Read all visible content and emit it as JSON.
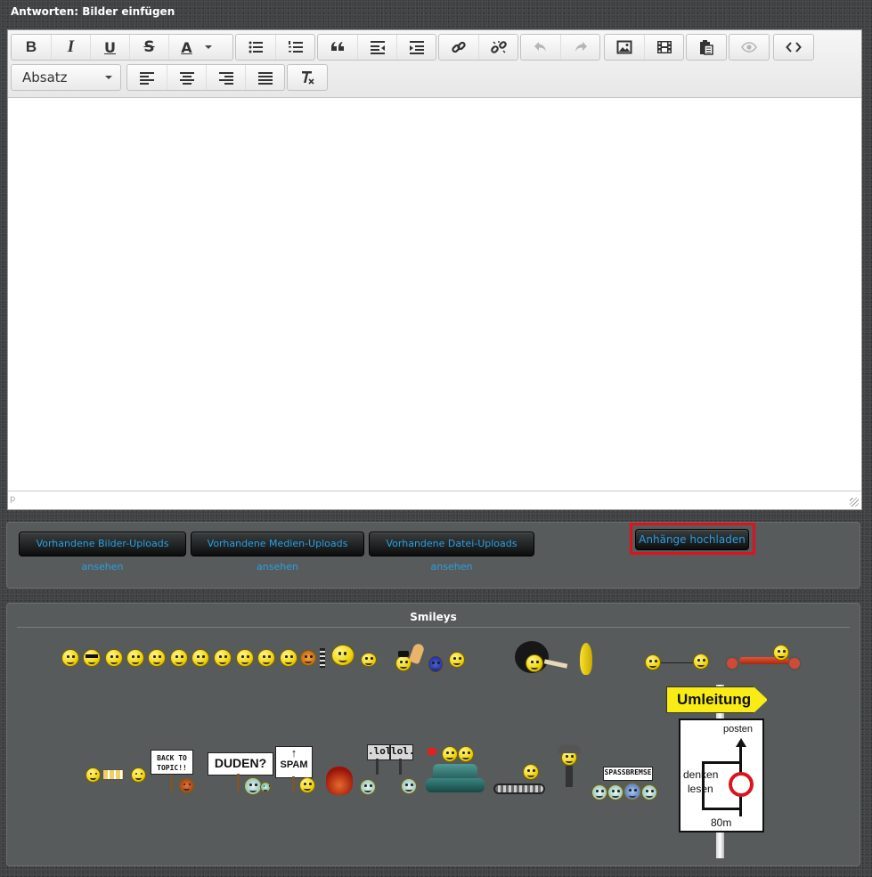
{
  "title": "Antworten: Bilder einfügen",
  "toolbar": {
    "row1": [
      {
        "name": "bold-button",
        "label": "B"
      },
      {
        "name": "italic-button",
        "label": "I"
      },
      {
        "name": "underline-button",
        "label": "U"
      },
      {
        "name": "strikethrough-button",
        "label": "S"
      },
      {
        "name": "font-color-button",
        "label": "A"
      },
      {
        "name": "bullet-list-button",
        "icon": "list-ul-icon"
      },
      {
        "name": "numbered-list-button",
        "icon": "list-ol-icon"
      },
      {
        "name": "blockquote-button",
        "icon": "quote-icon"
      },
      {
        "name": "outdent-button",
        "icon": "outdent-icon"
      },
      {
        "name": "indent-button",
        "icon": "indent-icon"
      },
      {
        "name": "link-button",
        "icon": "link-icon"
      },
      {
        "name": "unlink-button",
        "icon": "unlink-icon"
      },
      {
        "name": "undo-button",
        "icon": "undo-icon"
      },
      {
        "name": "redo-button",
        "icon": "redo-icon"
      },
      {
        "name": "image-button",
        "icon": "image-icon"
      },
      {
        "name": "media-button",
        "icon": "film-icon"
      },
      {
        "name": "paste-button",
        "icon": "clipboard-icon"
      },
      {
        "name": "preview-button",
        "icon": "eye-icon"
      },
      {
        "name": "source-code-button",
        "icon": "code-icon"
      }
    ],
    "format_select": "Absatz",
    "row2": [
      {
        "name": "align-left-button",
        "icon": "align-left-icon"
      },
      {
        "name": "align-center-button",
        "icon": "align-center-icon"
      },
      {
        "name": "align-right-button",
        "icon": "align-right-icon"
      },
      {
        "name": "align-justify-button",
        "icon": "align-justify-icon"
      },
      {
        "name": "clear-format-button",
        "icon": "clear-format-icon"
      }
    ]
  },
  "editor": {
    "content": "",
    "status_path": "p"
  },
  "uploads": {
    "buttons": [
      "Vorhandene Bilder-Uploads ansehen",
      "Vorhandene Medien-Uploads ansehen",
      "Vorhandene Datei-Uploads ansehen"
    ],
    "upload_button": "Anhänge hochladen",
    "highlight_color": "#e0111c"
  },
  "smileys": {
    "title": "Smileys",
    "signs": {
      "back_to_topic": "BACK TO TOPIC!!",
      "duden": "DUDEN?",
      "spam": "SPAM",
      "lol_1": ".lol",
      "lol_2": "lol.",
      "spassbremse": "SPASSBREMSE",
      "umleitung": "Umleitung",
      "posten": "posten",
      "denken": "denken",
      "lesen": "lesen",
      "distance": "80m"
    }
  },
  "colors": {
    "link_blue": "#2a9fe2",
    "panel": "#575b5b",
    "accent_yellow": "#f8ec14"
  }
}
